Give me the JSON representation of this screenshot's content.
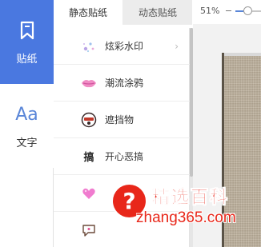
{
  "left_rail": {
    "items": [
      {
        "label": "贴纸",
        "icon": "sticker-bookmark-icon",
        "active": true
      },
      {
        "label": "文字",
        "icon": "text-aa-icon",
        "icon_text": "Aa",
        "active": false
      }
    ]
  },
  "tabs": [
    {
      "label": "静态贴纸",
      "active": true
    },
    {
      "label": "动态贴纸",
      "active": false
    }
  ],
  "zoom": {
    "percent": "51%",
    "level": 0.51
  },
  "sticker_list": [
    {
      "label": "炫彩水印",
      "icon": "sparkle-icon",
      "has_chevron": true
    },
    {
      "label": "潮流涂鸦",
      "icon": "lips-icon",
      "has_chevron": false
    },
    {
      "label": "遮挡物",
      "icon": "mask-face-icon",
      "has_chevron": false
    },
    {
      "label": "开心恶搞",
      "icon": "prank-glyph-icon",
      "icon_text": "搞",
      "has_chevron": false
    },
    {
      "label": "",
      "icon": "pink-heart-icon",
      "has_chevron": false
    },
    {
      "label": "",
      "icon": "speech-bubble-icon",
      "has_chevron": false
    }
  ],
  "chevron_glyph": "›",
  "watermark": {
    "glyph": "?",
    "title": "精选百科",
    "url": "zhang365.com"
  },
  "colors": {
    "accent": "#4a78e0",
    "watermark_red": "#e8271a"
  }
}
